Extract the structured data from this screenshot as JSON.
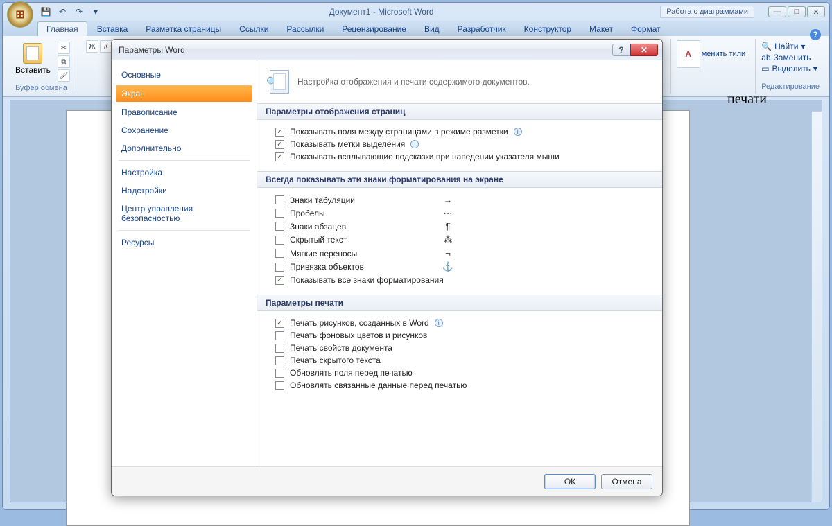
{
  "window": {
    "title": "Документ1 - Microsoft Word",
    "context_tab": "Работа с диаграммами"
  },
  "ribbon": {
    "tabs": [
      "Главная",
      "Вставка",
      "Разметка страницы",
      "Ссылки",
      "Рассылки",
      "Рецензирование",
      "Вид",
      "Разработчик",
      "Конструктор",
      "Макет",
      "Формат"
    ],
    "active_tab_index": 0,
    "paste_label": "Вставить",
    "clipboard_group": "Буфер обмена",
    "editing": {
      "find": "Найти",
      "replace": "Заменить",
      "select": "Выделить",
      "group": "Редактирование"
    },
    "styles_caption": "менить\nтили",
    "styles_AA": "A"
  },
  "page_text": "печати",
  "dialog": {
    "title": "Параметры Word",
    "sidebar": [
      "Основные",
      "Экран",
      "Правописание",
      "Сохранение",
      "Дополнительно",
      "Настройка",
      "Надстройки",
      "Центр управления безопасностью",
      "Ресурсы"
    ],
    "selected_sidebar_index": 1,
    "header": "Настройка отображения и печати содержимого документов.",
    "section1": {
      "title": "Параметры отображения страниц",
      "items": [
        {
          "checked": true,
          "label": "Показывать поля между страницами в режиме разметки",
          "info": true
        },
        {
          "checked": true,
          "label": "Показывать метки выделения",
          "info": true
        },
        {
          "checked": true,
          "label": "Показывать всплывающие подсказки при наведении указателя мыши"
        }
      ]
    },
    "section2": {
      "title": "Всегда показывать эти знаки форматирования на экране",
      "items": [
        {
          "checked": false,
          "label": "Знаки табуляции",
          "sym": "→"
        },
        {
          "checked": false,
          "label": "Пробелы",
          "sym": "···"
        },
        {
          "checked": false,
          "label": "Знаки абзацев",
          "sym": "¶"
        },
        {
          "checked": false,
          "label": "Скрытый текст",
          "sym": "⁂"
        },
        {
          "checked": false,
          "label": "Мягкие переносы",
          "sym": "¬"
        },
        {
          "checked": false,
          "label": "Привязка объектов",
          "sym": "⚓"
        },
        {
          "checked": true,
          "label": "Показывать все знаки форматирования"
        }
      ]
    },
    "section3": {
      "title": "Параметры печати",
      "items": [
        {
          "checked": true,
          "label": "Печать рисунков, созданных в Word",
          "info": true
        },
        {
          "checked": false,
          "label": "Печать фоновых цветов и рисунков"
        },
        {
          "checked": false,
          "label": "Печать свойств документа"
        },
        {
          "checked": false,
          "label": "Печать скрытого текста"
        },
        {
          "checked": false,
          "label": "Обновлять поля перед печатью"
        },
        {
          "checked": false,
          "label": "Обновлять связанные данные перед печатью"
        }
      ]
    },
    "buttons": {
      "ok": "ОК",
      "cancel": "Отмена"
    }
  }
}
